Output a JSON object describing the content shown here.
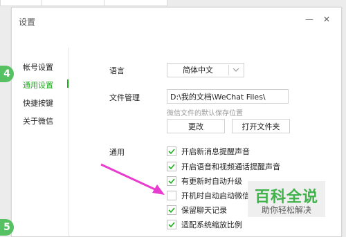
{
  "window": {
    "title": "设置",
    "minimize_symbol": "—",
    "close_symbol": "✕"
  },
  "sidebar": {
    "items": [
      {
        "label": "帐号设置",
        "active": false
      },
      {
        "label": "通用设置",
        "active": true
      },
      {
        "label": "快捷按键",
        "active": false
      },
      {
        "label": "关于微信",
        "active": false
      }
    ]
  },
  "settings": {
    "language_label": "语言",
    "language_value": "简体中文",
    "file_management_label": "文件管理",
    "file_path": "D:\\我的文档\\WeChat Files\\",
    "file_hint": "微信文件的默认保存位置",
    "change_button": "更改",
    "open_folder_button": "打开文件夹",
    "general_label": "通用",
    "options": [
      {
        "label": "开启新消息提醒声音",
        "checked": true
      },
      {
        "label": "开启语音和视频通话提醒声音",
        "checked": true
      },
      {
        "label": "有更新时自动升级",
        "checked": true
      },
      {
        "label": "开机时自动启动微信",
        "checked": false
      },
      {
        "label": "保留聊天记录",
        "checked": true
      },
      {
        "label": "适配系统缩放比例",
        "checked": true
      }
    ]
  },
  "steps": {
    "step4": "4",
    "step5": "5"
  },
  "watermark": {
    "title": "百科全说",
    "subtitle": "助你轻松解决"
  },
  "colors": {
    "accent": "#1aad19",
    "step_badge": "#56c163",
    "arrow": "#e83ccf"
  },
  "icons": {
    "select_chevron": "chevron-down-icon",
    "check": "checkmark-icon"
  }
}
